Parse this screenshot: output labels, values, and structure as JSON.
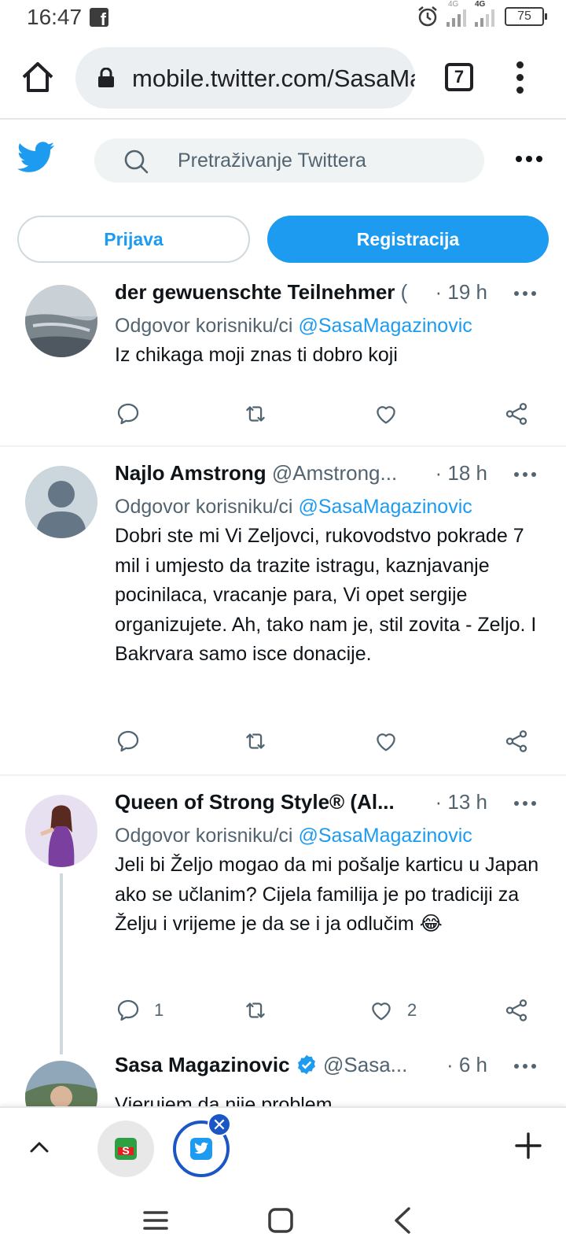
{
  "status_bar": {
    "time": "16:47",
    "network_1": "4G",
    "network_2": "4G",
    "battery": "75"
  },
  "browser": {
    "url": "mobile.twitter.com/SasaMagazinovic",
    "tab_count": "7"
  },
  "twitter": {
    "search_placeholder": "Pretraživanje Twittera",
    "login_label": "Prijava",
    "signup_label": "Registracija",
    "brand_color": "#1d9bf0"
  },
  "tweets": [
    {
      "name": "der gewuenschte Teilnehmer",
      "handle": "(",
      "time": "· 19 h",
      "reply_prefix": "Odgovor korisniku/ci ",
      "reply_mention": "@SasaMagazinovic",
      "text": "Iz chikaga moji znas ti dobro koji",
      "replies": "",
      "likes": ""
    },
    {
      "name": "Najlo Amstrong",
      "handle": "@Amstrong...",
      "time": "· 18 h",
      "reply_prefix": "Odgovor korisniku/ci ",
      "reply_mention": "@SasaMagazinovic",
      "text": "Dobri ste mi Vi Zeljovci, rukovodstvo pokrade 7 mil i umjesto da trazite istragu, kaznjavanje pocinilaca, vracanje para, Vi opet sergije organizujete. Ah, tako nam je, stil zovita - Zeljo. I Bakrvara samo isce donacije.",
      "replies": "",
      "likes": ""
    },
    {
      "name": "Queen of Strong Style® (Al...",
      "handle": "",
      "time": "· 13 h",
      "reply_prefix": "Odgovor korisniku/ci ",
      "reply_mention": "@SasaMagazinovic",
      "text": "Jeli bi Željo mogao da mi pošalje karticu u Japan ako se učlanim? Cijela familija je po tradiciji za Želju i vrijeme je da se i ja odlučim 😂",
      "replies": "1",
      "likes": "2"
    },
    {
      "name": "Sasa Magazinovic",
      "handle": "@Sasa...",
      "time": "· 6 h",
      "text": "Vjerujem da nije problem"
    }
  ]
}
